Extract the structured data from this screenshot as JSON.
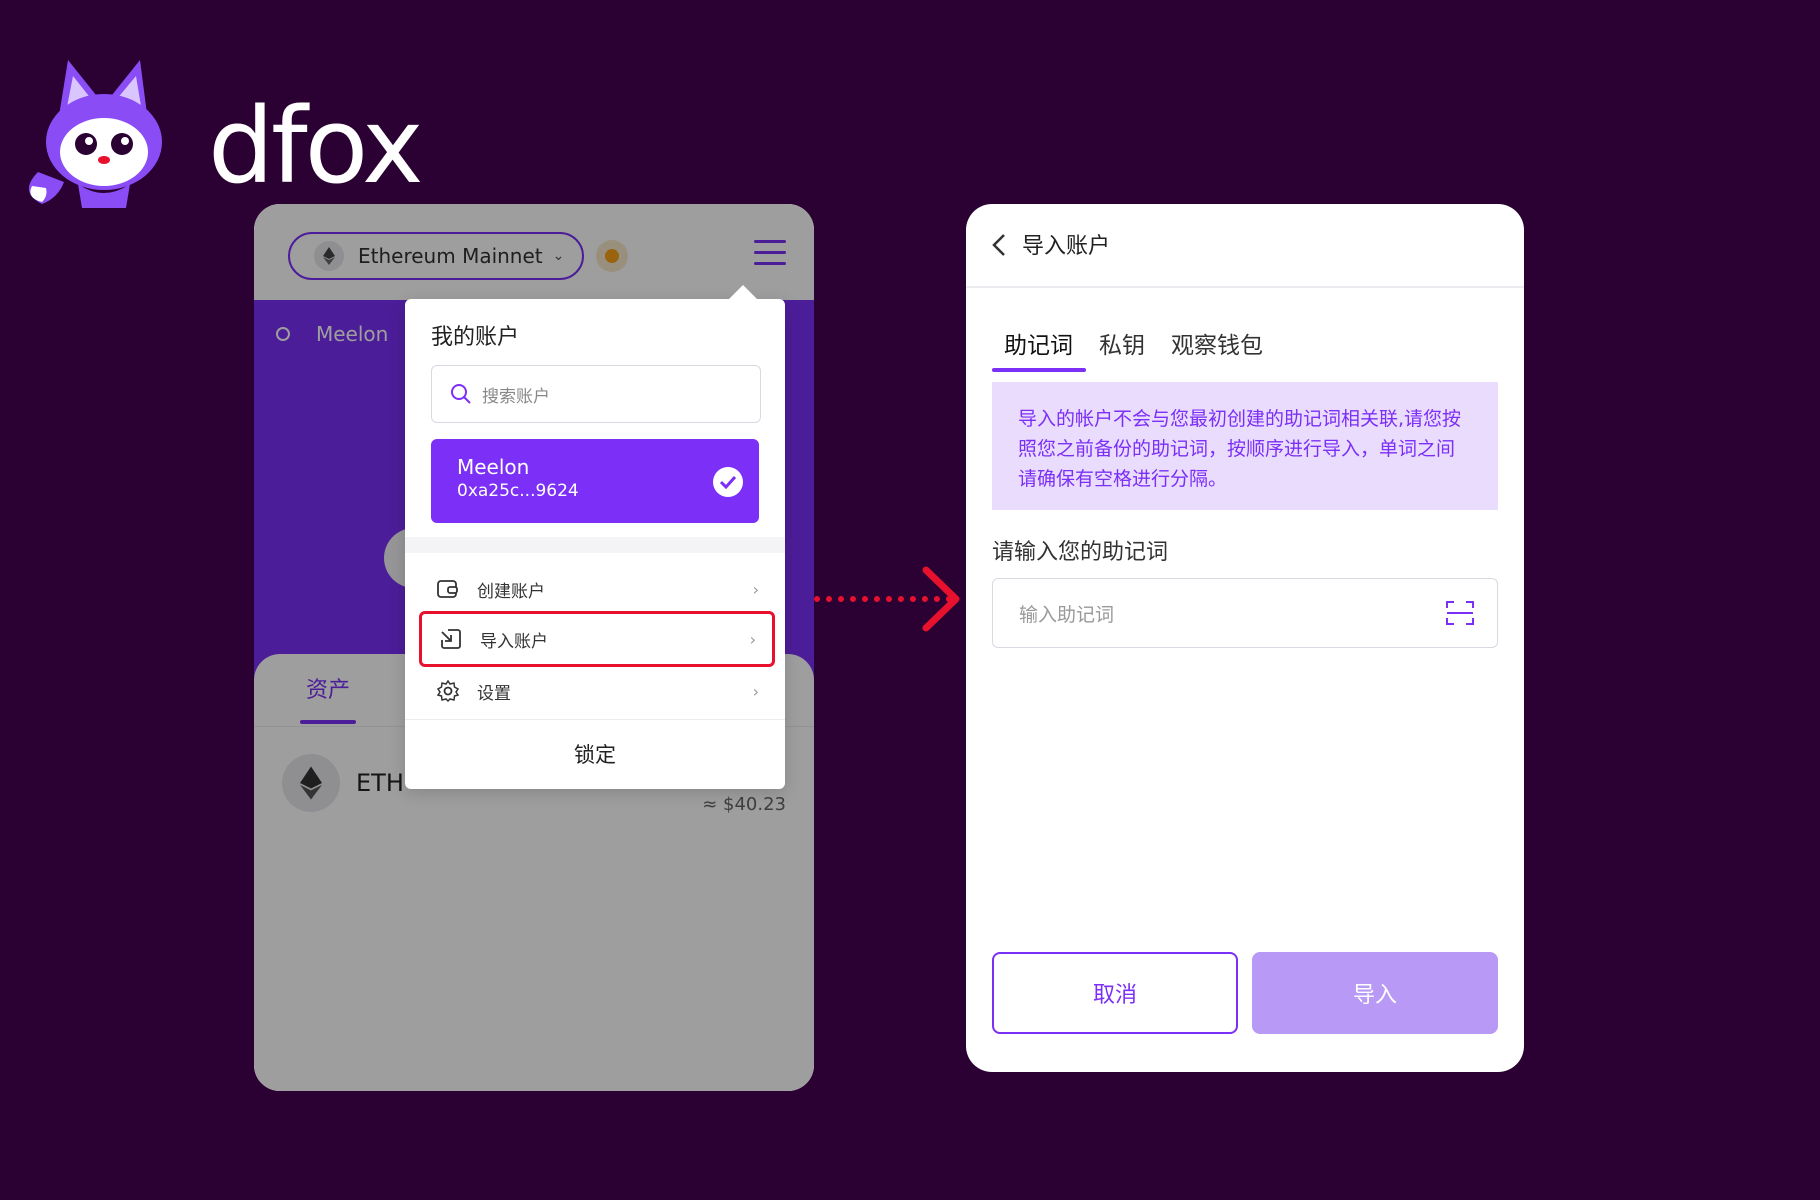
{
  "brand": {
    "name": "dfox"
  },
  "wallet": {
    "network_label": "Ethereum Mainnet",
    "account_short": "Meelon",
    "assets_tab": "资产",
    "asset_symbol": "ETH",
    "asset_usd": "≈ $40.23"
  },
  "dropdown": {
    "title": "我的账户",
    "search_placeholder": "搜索账户",
    "account": {
      "name": "Meelon",
      "address": "0xa25c...9624"
    },
    "items": [
      {
        "label": "创建账户",
        "icon": "wallet-icon"
      },
      {
        "label": "导入账户",
        "icon": "import-icon"
      },
      {
        "label": "设置",
        "icon": "gear-icon"
      }
    ],
    "lock_label": "锁定"
  },
  "import_page": {
    "title": "导入账户",
    "tabs": [
      "助记词",
      "私钥",
      "观察钱包"
    ],
    "active_tab": 0,
    "notice": "导入的帐户不会与您最初创建的助记词相关联,请您按照您之前备份的助记词，按顺序进行导入，单词之间请确保有空格进行分隔。",
    "input_label": "请输入您的助记词",
    "input_placeholder": "输入助记词",
    "cancel_label": "取消",
    "import_label": "导入"
  },
  "colors": {
    "background": "#2b0033",
    "accent": "#7b2ff7",
    "highlight": "#e8112d",
    "notice_bg": "#eadcfd",
    "import_disabled": "#b899f6"
  }
}
